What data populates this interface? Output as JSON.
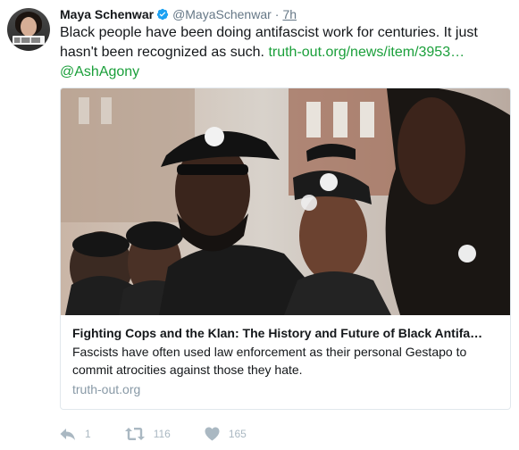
{
  "user": {
    "name": "Maya Schenwar",
    "handle": "@MayaSchenwar",
    "separator": "·",
    "time": "7h"
  },
  "tweet": {
    "text": "Black people have been doing antifascist work for centuries. It just hasn't been recognized as such.",
    "link": "truth-out.org/news/item/3953…",
    "mention": "@AshAgony"
  },
  "card": {
    "title": "Fighting Cops and the Klan: The History and Future of Black Antifa…",
    "description": "Fascists have often used law enforcement as their personal Gestapo to commit atrocities against those they hate.",
    "domain": "truth-out.org"
  },
  "actions": {
    "reply_count": "1",
    "retweet_count": "116",
    "like_count": "165"
  },
  "icons": {
    "verified": "verified-badge-icon",
    "reply": "reply-icon",
    "retweet": "retweet-icon",
    "like": "heart-icon"
  },
  "colors": {
    "link": "#1a9f3a",
    "secondary_text": "#657786",
    "action_icon": "#aab8c2",
    "verified": "#1da1f2"
  }
}
